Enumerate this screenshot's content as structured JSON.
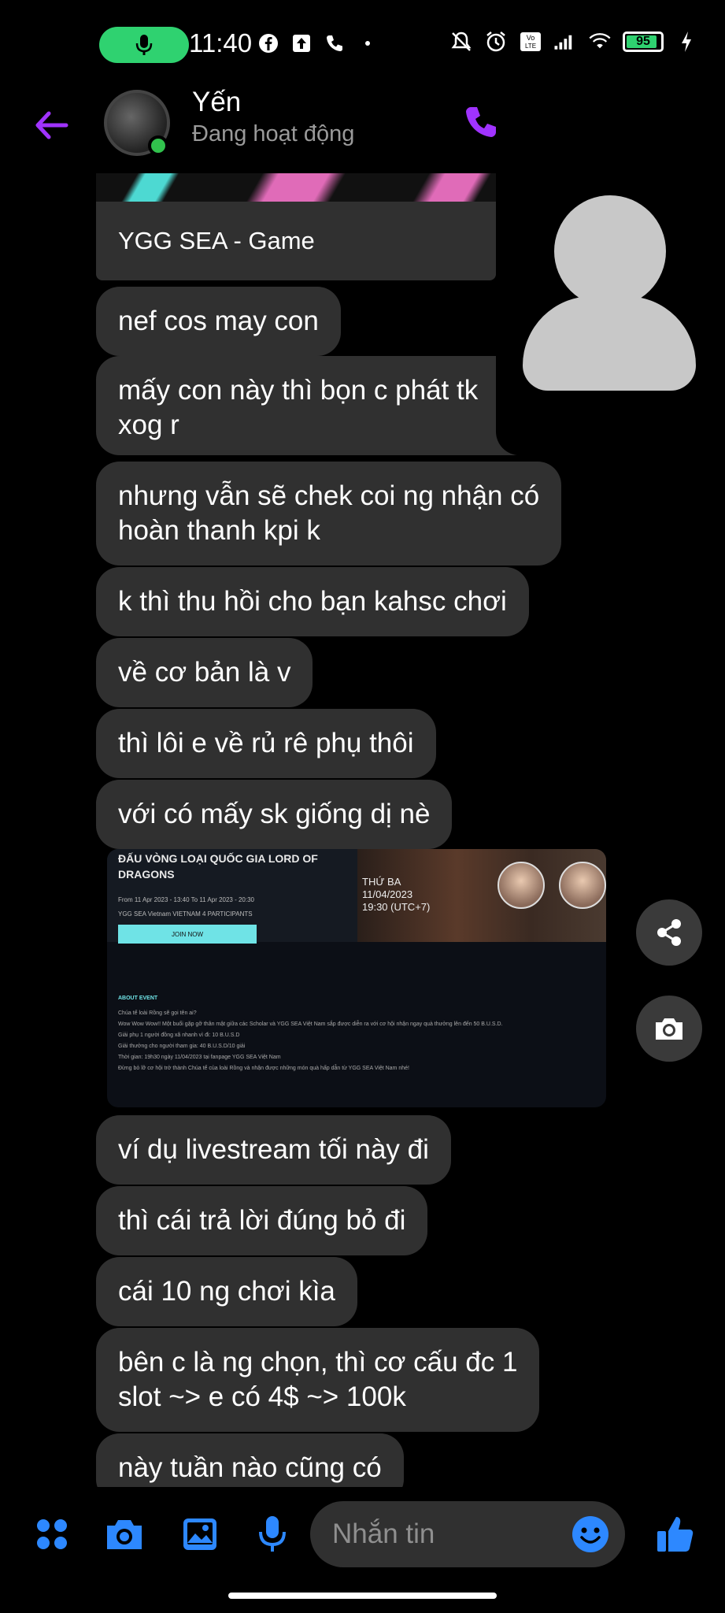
{
  "status_bar": {
    "time": "11:40",
    "battery_level": "95",
    "network_badge": "Vo LTE",
    "icons_left": [
      "facebook-icon",
      "upload-icon",
      "phone-icon",
      "dot-icon"
    ],
    "icons_right": [
      "mute-bell-icon",
      "alarm-icon",
      "volte-icon",
      "signal-icon",
      "wifi-icon",
      "battery-icon",
      "charging-icon"
    ],
    "colors": {
      "mic_pill": "#2fd270",
      "battery_fill": "#2fd270"
    }
  },
  "header": {
    "contact_name": "Yến",
    "status": "Đang hoạt động",
    "accent": "#a033ff"
  },
  "link_preview": {
    "title": "YGG SEA - Game"
  },
  "messages": [
    {
      "text": "nef cos may con"
    },
    {
      "text": "mấy con này thì bọn c phát tk\nxog r"
    },
    {
      "text": "nhưng vẫn sẽ chek coi ng nhận có\nhoàn thanh kpi k"
    },
    {
      "text": "k thì thu hồi cho bạn kahsc chơi"
    },
    {
      "text": "về cơ bản là v"
    },
    {
      "text": "thì lôi e về rủ rê phụ thôi"
    },
    {
      "text": "với có mấy sk giống dị nè"
    },
    {
      "text": "ví dụ livestream tối này đi"
    },
    {
      "text": "thì cái trả lời đúng bỏ đi"
    },
    {
      "text": "cái 10 ng chơi kìa"
    },
    {
      "text": "bên c là ng chọn, thì cơ cấu đc 1\nslot ~> e có 4$ ~> 100k"
    },
    {
      "text": "này tuần nào cũng có"
    }
  ],
  "shared_image": {
    "heading": "ĐẤU VÒNG LOẠI QUỐC GIA LORD OF DRAGONS",
    "meta": "From 11 Apr 2023 - 13:40  To 11 Apr 2023 - 20:30",
    "meta2": "YGG SEA Vietnam   VIETNAM   4 PARTICIPANTS",
    "join_label": "JOIN NOW",
    "banner_text": "THỨ BA\n11/04/2023\n19:30 (UTC+7)",
    "about_label": "ABOUT EVENT",
    "about_lines": "Chúa tể loài Rồng sẽ gọi tên ai?\nWow Wow Wow!! Một buổi gặp gỡ thân mật giữa các Scholar và YGG SEA Việt Nam sắp được diễn ra với cơ hội nhận ngay quà thưởng lên đến 50 B.U.S.D.\nGiải phụ 1 người đồng xã nhanh vì đi: 10 B.U.S.D\nGiải thưởng cho người tham gia: 40 B.U.S.D/10 giải\nThời gian: 19h30 ngày 11/04/2023 tại fanpage YGG SEA Việt Nam\nĐừng bỏ lỡ cơ hội trở thành Chúa tể của loài Rồng và nhận được những món quà hấp dẫn từ YGG SEA Việt Nam nhé!"
  },
  "composer": {
    "placeholder": "Nhắn tin",
    "accent": "#2d88ff",
    "icons": [
      "apps-icon",
      "camera-icon",
      "gallery-icon",
      "mic-icon",
      "emoji-icon",
      "like-icon"
    ]
  },
  "floating_buttons": [
    "share-icon",
    "camera-icon"
  ]
}
